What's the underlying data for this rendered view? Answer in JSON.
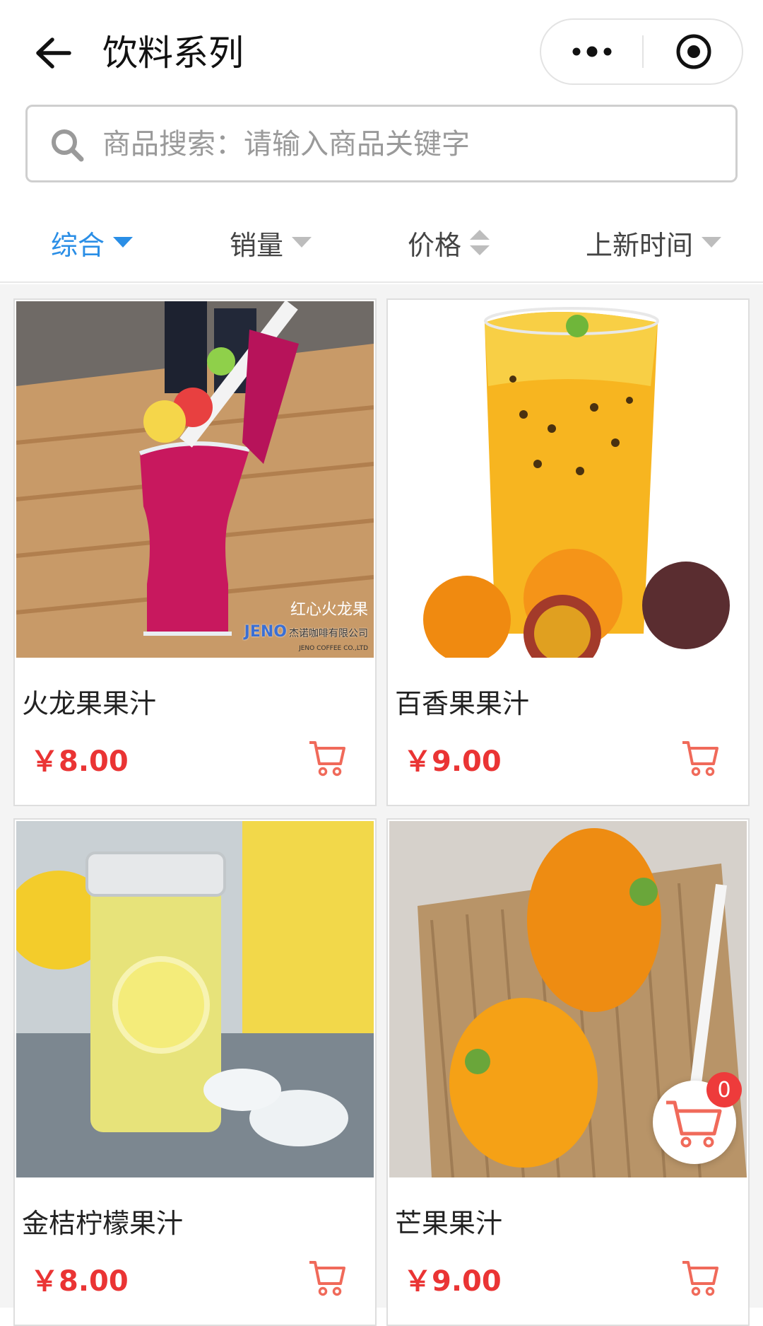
{
  "header": {
    "title": "饮料系列"
  },
  "search": {
    "placeholder": "商品搜索：请输入商品关键字"
  },
  "sort": {
    "items": [
      {
        "label": "综合",
        "active": true
      },
      {
        "label": "销量",
        "active": false
      },
      {
        "label": "价格",
        "active": false
      },
      {
        "label": "上新时间",
        "active": false
      }
    ]
  },
  "products": [
    {
      "name": "火龙果果汁",
      "price": "￥8.00",
      "image_text": "红心火龙果",
      "brand": "JENO",
      "brand_cn": "杰诺咖啡有限公司",
      "brand_en": "JENO COFFEE CO.,LTD"
    },
    {
      "name": "百香果果汁",
      "price": "￥9.00"
    },
    {
      "name": "金桔柠檬果汁",
      "price": "￥8.00"
    },
    {
      "name": "芒果果汁",
      "price": "￥9.00"
    }
  ],
  "cart": {
    "count": "0"
  },
  "colors": {
    "accent": "#2a8ee6",
    "price": "#ea3434",
    "cart_icon": "#f06a5a",
    "badge": "#ee3b3b"
  }
}
